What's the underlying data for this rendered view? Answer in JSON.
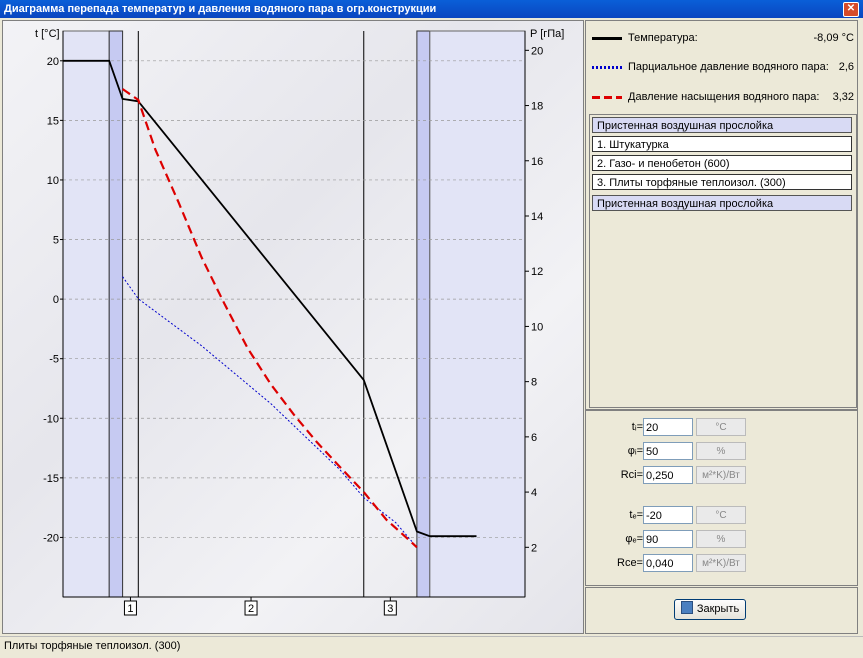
{
  "window": {
    "title": "Диаграмма перепада температур и давления водяного пара в огр.конструкции",
    "close_glyph": "✕"
  },
  "chart": {
    "left_axis_label": "t [°C]",
    "right_axis_label": "P [гПа]",
    "layer_markers": [
      "1",
      "2",
      "3"
    ]
  },
  "chart_data": {
    "type": "line",
    "x_units": "position across construction (layer boundaries)",
    "left_axis": {
      "label": "t [°C]",
      "range": [
        -25,
        22.5
      ],
      "ticks": [
        20,
        15,
        10,
        5,
        0,
        -5,
        -10,
        -15,
        -20
      ]
    },
    "right_axis": {
      "label": "P [гПа]",
      "range": [
        0.2,
        20.7
      ],
      "ticks": [
        20,
        18,
        16,
        14,
        12,
        10,
        8,
        6,
        4,
        2
      ]
    },
    "layers": [
      {
        "name": "Пристенная воздушная прослойка",
        "shaded": true
      },
      {
        "name": "1. Штукатурка",
        "marker": "1"
      },
      {
        "name": "2. Газо- и пенобетон (600)",
        "marker": "2"
      },
      {
        "name": "3. Плиты торфяные теплоизол. (300)",
        "marker": "3"
      },
      {
        "name": "Пристенная воздушная прослойка",
        "shaded": true
      }
    ],
    "series": [
      {
        "name": "Температура",
        "axis": "left",
        "color": "#000000",
        "style": "solid",
        "points": [
          [
            0,
            20
          ],
          [
            0.1,
            20
          ],
          [
            0.129,
            16.8
          ],
          [
            0.163,
            16.6
          ],
          [
            0.651,
            -6.8
          ],
          [
            0.766,
            -19.5
          ],
          [
            0.794,
            -19.9
          ],
          [
            0.895,
            -19.9
          ]
        ]
      },
      {
        "name": "Парциальное давление водяного пара",
        "axis": "right",
        "color": "#0000cc",
        "style": "dotted",
        "points": [
          [
            0.129,
            11.8
          ],
          [
            0.163,
            11.0
          ],
          [
            0.3,
            9.3
          ],
          [
            0.45,
            7.2
          ],
          [
            0.6,
            4.8
          ],
          [
            0.651,
            3.8
          ],
          [
            0.72,
            2.9
          ],
          [
            0.766,
            2.0
          ]
        ]
      },
      {
        "name": "Давление насыщения водяного пара",
        "axis": "right",
        "color": "#dd0000",
        "style": "dashed",
        "points": [
          [
            0.129,
            18.6
          ],
          [
            0.163,
            18.2
          ],
          [
            0.2,
            16.4
          ],
          [
            0.25,
            14.5
          ],
          [
            0.3,
            12.5
          ],
          [
            0.35,
            10.8
          ],
          [
            0.4,
            9.2
          ],
          [
            0.45,
            7.9
          ],
          [
            0.5,
            6.8
          ],
          [
            0.55,
            5.8
          ],
          [
            0.6,
            4.9
          ],
          [
            0.651,
            4.0
          ],
          [
            0.7,
            3.0
          ],
          [
            0.74,
            2.4
          ],
          [
            0.766,
            2.0
          ]
        ]
      }
    ]
  },
  "legend": {
    "temperature": {
      "label": "Температура:",
      "value": "-8,09 °C",
      "color": "#000000"
    },
    "partial": {
      "label": "Парциальное давление водяного пара:",
      "value": "2,6",
      "color": "#0000cc"
    },
    "saturation": {
      "label": "Давление насыщения водяного пара:",
      "value": "3,32",
      "color": "#dd0000"
    }
  },
  "layers_list": [
    {
      "label": "Пристенная воздушная прослойка",
      "kind": "air"
    },
    {
      "label": "1. Штукатурка",
      "kind": "layer"
    },
    {
      "label": "2. Газо- и пенобетон (600)",
      "kind": "layer"
    },
    {
      "label": "3. Плиты торфяные теплоизол. (300)",
      "kind": "layer"
    },
    {
      "label": "Пристенная воздушная прослойка",
      "kind": "air"
    }
  ],
  "params": {
    "ti": {
      "label": "tᵢ=",
      "value": "20",
      "unit": "°C"
    },
    "phii": {
      "label": "φᵢ=",
      "value": "50",
      "unit": "%"
    },
    "rsi": {
      "label": "Rсi=",
      "value": "0,250",
      "unit": "м²*K)/Вт"
    },
    "te": {
      "label": "tₑ=",
      "value": "-20",
      "unit": "°C"
    },
    "phie": {
      "label": "φₑ=",
      "value": "90",
      "unit": "%"
    },
    "rse": {
      "label": "Rсe=",
      "value": "0,040",
      "unit": "м²*K)/Вт"
    }
  },
  "close_button": {
    "label": "Закрыть"
  },
  "status": {
    "text": "Плиты торфяные теплоизол. (300)"
  }
}
